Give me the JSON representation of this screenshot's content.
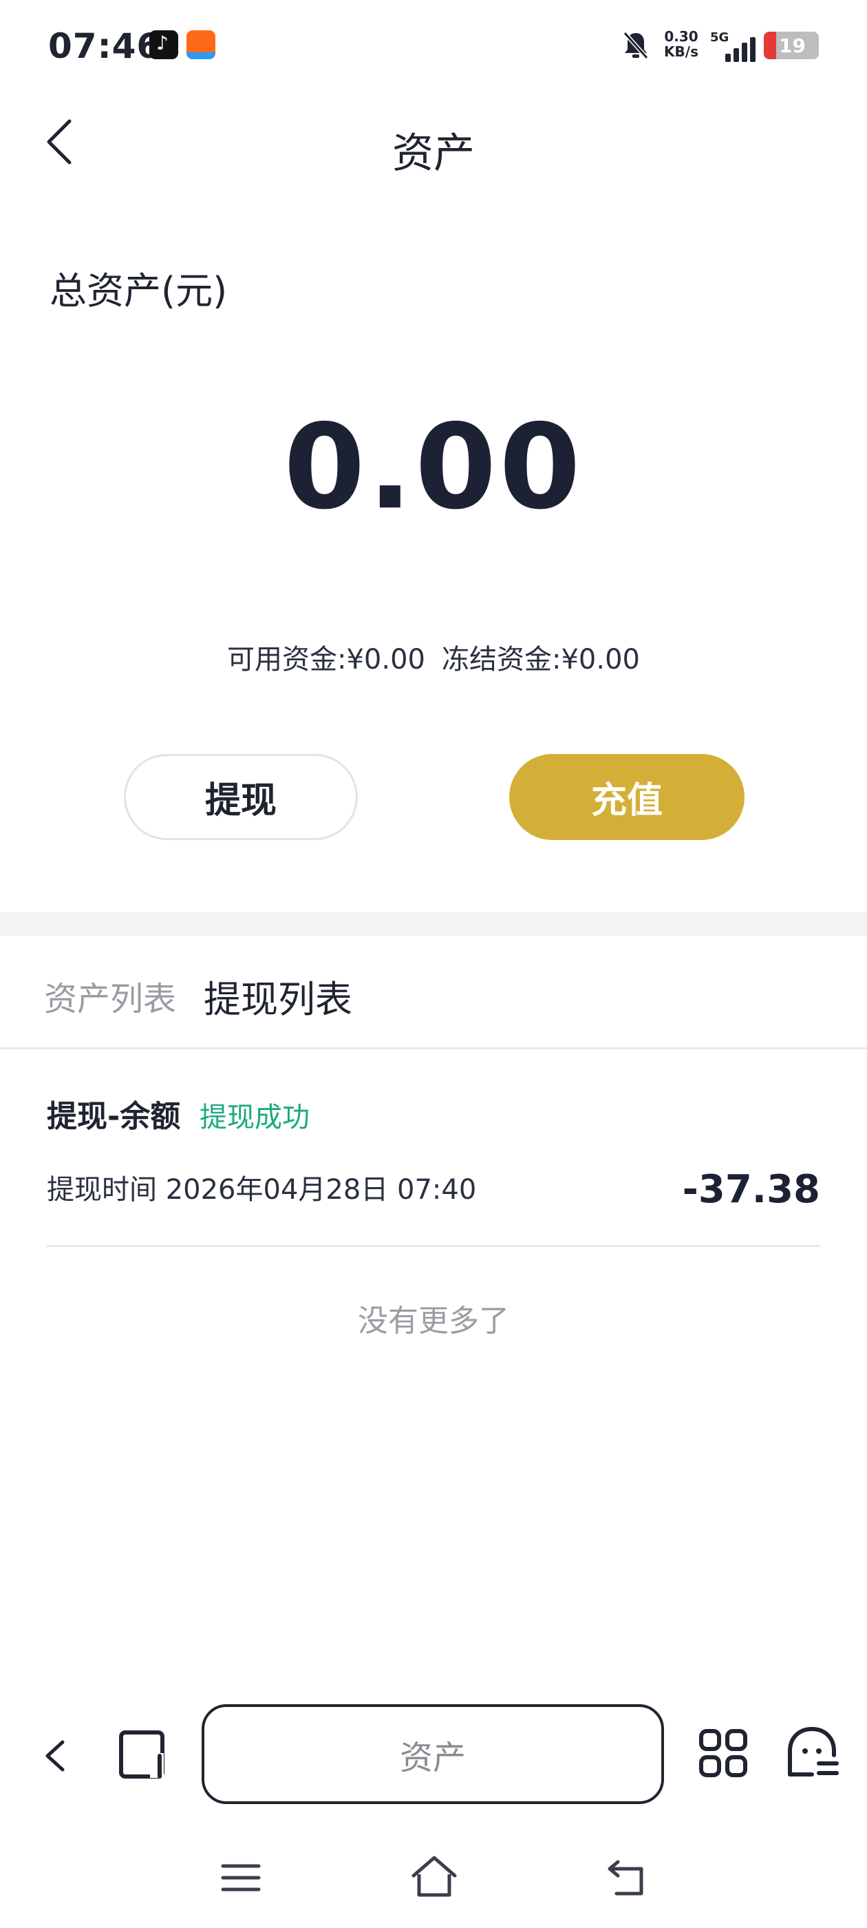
{
  "status_bar": {
    "time": "07:46",
    "net_speed_value": "0.30",
    "net_speed_unit": "KB/s",
    "network": "5G",
    "battery": "19"
  },
  "header": {
    "title": "资产"
  },
  "assets": {
    "total_label": "总资产(元)",
    "total_amount": "0.00",
    "available": "可用资金:¥0.00",
    "frozen": "冻结资金:¥0.00"
  },
  "actions": {
    "withdraw_label": "提现",
    "recharge_label": "充值",
    "recharge_color": "#d4af37"
  },
  "tabs": {
    "asset_list": "资产列表",
    "withdraw_list": "提现列表"
  },
  "records": [
    {
      "title": "提现-余额",
      "status": "提现成功",
      "time": "提现时间 2026年04月28日 07:40",
      "amount": "-37.38"
    }
  ],
  "footer": {
    "no_more": "没有更多了"
  },
  "browser_toolbar": {
    "address_text": "资产"
  }
}
